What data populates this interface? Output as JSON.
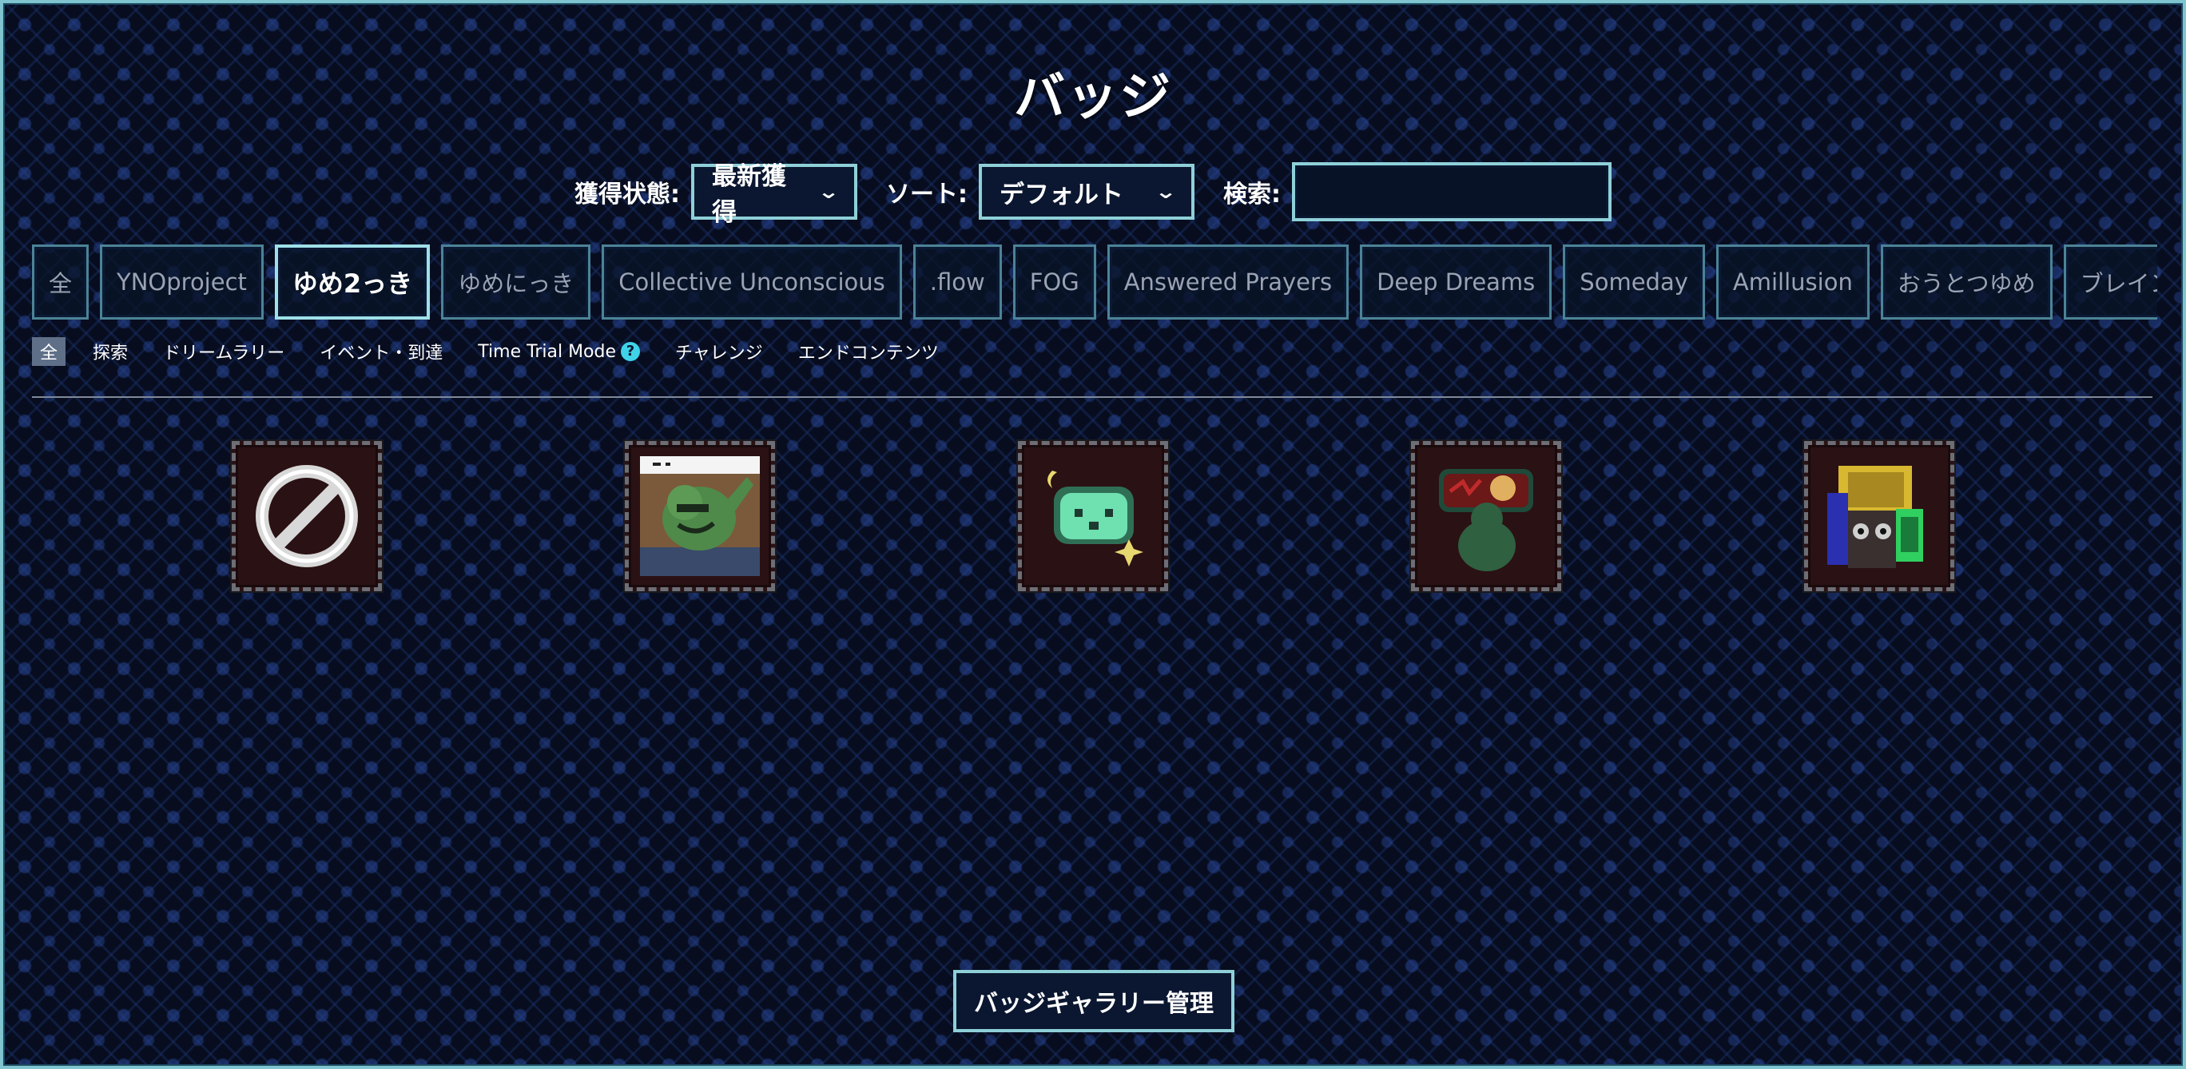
{
  "title": "バッジ",
  "filters": {
    "status_label": "獲得状態:",
    "status_value": "最新獲得",
    "sort_label": "ソート:",
    "sort_value": "デフォルト",
    "search_label": "検索:",
    "search_value": ""
  },
  "game_tabs": [
    {
      "label": "全",
      "active": false
    },
    {
      "label": "YNOproject",
      "active": false
    },
    {
      "label": "ゆめ2っき",
      "active": true
    },
    {
      "label": "ゆめにっき",
      "active": false
    },
    {
      "label": "Collective Unconscious",
      "active": false
    },
    {
      "label": ".flow",
      "active": false
    },
    {
      "label": "FOG",
      "active": false
    },
    {
      "label": "Answered Prayers",
      "active": false
    },
    {
      "label": "Deep Dreams",
      "active": false
    },
    {
      "label": "Someday",
      "active": false
    },
    {
      "label": "Amillusion",
      "active": false
    },
    {
      "label": "おうとつゆめ",
      "active": false
    },
    {
      "label": "ブレインガール",
      "active": false
    }
  ],
  "category_tabs": [
    {
      "label": "全",
      "active": true
    },
    {
      "label": "探索",
      "active": false
    },
    {
      "label": "ドリームラリー",
      "active": false
    },
    {
      "label": "イベント・到達",
      "active": false
    },
    {
      "label": "Time Trial Mode",
      "active": false,
      "help": "?"
    },
    {
      "label": "チャレンジ",
      "active": false
    },
    {
      "label": "エンドコンテンツ",
      "active": false
    }
  ],
  "badges": [
    {
      "icon": "no-badge-icon"
    },
    {
      "icon": "green-creature-badge-icon"
    },
    {
      "icon": "ghost-lantern-badge-icon"
    },
    {
      "icon": "red-sign-girl-badge-icon"
    },
    {
      "icon": "bookshelf-robot-badge-icon"
    }
  ],
  "manage_button": "バッジギャラリー管理",
  "colors": {
    "accent_border": "#8fd0d8",
    "badge_bg": "#2a1114",
    "background": "#070d1f"
  }
}
